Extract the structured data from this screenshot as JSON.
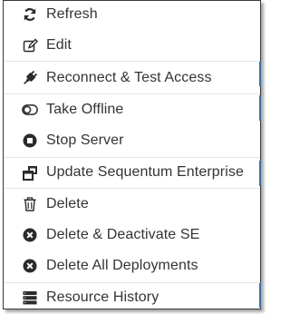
{
  "menu": {
    "items": [
      {
        "label": "Refresh",
        "icon": "refresh-icon"
      },
      {
        "label": "Edit",
        "icon": "edit-icon"
      },
      {
        "label": "Reconnect & Test Access",
        "icon": "plug-icon"
      },
      {
        "label": "Take Offline",
        "icon": "toggle-off-icon"
      },
      {
        "label": "Stop Server",
        "icon": "stop-icon"
      },
      {
        "label": "Update Sequentum Enterprise",
        "icon": "windows-restore-icon"
      },
      {
        "label": "Delete",
        "icon": "trash-icon"
      },
      {
        "label": "Delete & Deactivate SE",
        "icon": "times-circle-icon"
      },
      {
        "label": "Delete All Deployments",
        "icon": "times-circle-icon"
      },
      {
        "label": "Resource History",
        "icon": "server-list-icon"
      }
    ]
  },
  "colors": {
    "text": "#333333",
    "icon": "#2b2b2b",
    "separator": "#e6e6e6",
    "border": "#3a3a3a",
    "accent": "#3c6fa3"
  }
}
